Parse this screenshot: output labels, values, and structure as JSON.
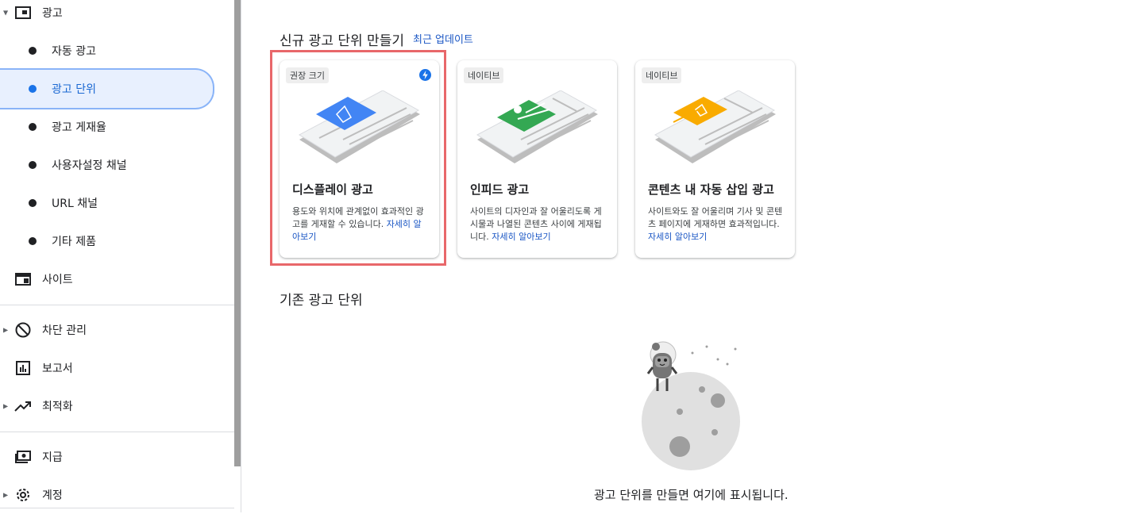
{
  "sidebar": {
    "ads_section": "광고",
    "sub_items": [
      "자동 광고",
      "광고 단위",
      "광고 게재율",
      "사용자설정 채널",
      "URL 채널",
      "기타 제품"
    ],
    "sites": "사이트",
    "blocking": "차단 관리",
    "reports": "보고서",
    "optimization": "최적화",
    "payments": "지급",
    "account": "계정"
  },
  "main": {
    "new_heading": "신규 광고 단위 만들기",
    "recent_updates": "최근 업데이트",
    "cards": [
      {
        "badge": "권장 크기",
        "title": "디스플레이 광고",
        "desc": "용도와 위치에 관계없이 효과적인 광고를 게재할 수 있습니다.",
        "link": "자세히 알아보기",
        "accent": "#4285f4"
      },
      {
        "badge": "네이티브",
        "title": "인피드 광고",
        "desc": "사이트의 디자인과 잘 어울리도록 게시물과 나열된 콘텐츠 사이에 게재됩니다.",
        "link": "자세히 알아보기",
        "accent": "#34a853"
      },
      {
        "badge": "네이티브",
        "title": "콘텐츠 내 자동 삽입 광고",
        "desc": "사이트와도 잘 어울리며 기사 및 콘텐츠 페이지에 게재하면 효과적입니다.",
        "link": "자세히 알아보기",
        "accent": "#f9ab00"
      }
    ],
    "existing_heading": "기존 광고 단위",
    "empty_message": "광고 단위를 만들면 여기에 표시됩니다."
  },
  "colors": {
    "active_bg": "#e8f0fe",
    "active_text": "#1967d2",
    "link": "#1a56c4",
    "highlight": "#e8676a"
  }
}
